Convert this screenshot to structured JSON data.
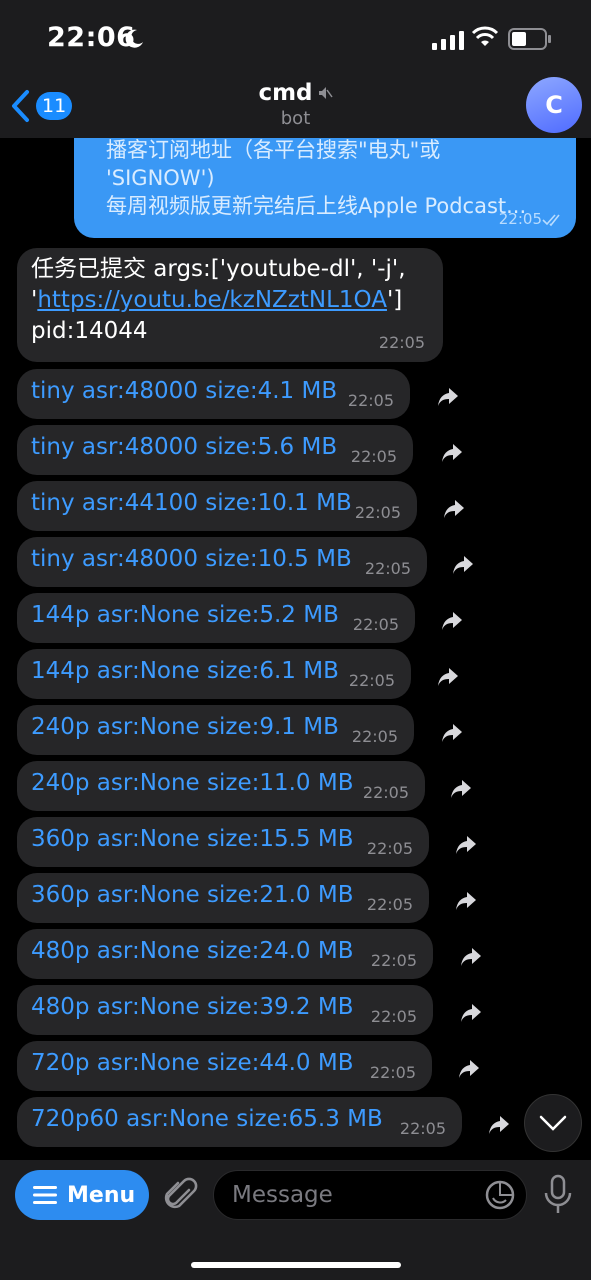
{
  "status_bar": {
    "time": "22:06"
  },
  "nav": {
    "back_count": "11",
    "title": "cmd",
    "subtitle": "bot",
    "avatar_letter": "C"
  },
  "outgoing": {
    "lines": [
      "播客订阅地址（各平台搜索\"电丸\"或",
      "'SIGNOW')",
      "每周视频版更新完结后上线Apple Podcast..."
    ],
    "time": "22:05"
  },
  "task_message": {
    "line1": "任务已提交 args:['youtube-dl', '-j',",
    "line2_prefix": "'",
    "link": "https://youtu.be/kzNZztNL1OA",
    "line2_suffix": "']",
    "line3": "pid:14044",
    "time": "22:05"
  },
  "formats": [
    {
      "label": "tiny asr:48000 size:4.1 MB",
      "time": "22:05"
    },
    {
      "label": "tiny asr:48000 size:5.6 MB",
      "time": "22:05"
    },
    {
      "label": "tiny asr:44100 size:10.1 MB",
      "time": "22:05"
    },
    {
      "label": "tiny asr:48000 size:10.5 MB",
      "time": "22:05"
    },
    {
      "label": "144p asr:None size:5.2 MB",
      "time": "22:05"
    },
    {
      "label": "144p asr:None size:6.1 MB",
      "time": "22:05"
    },
    {
      "label": "240p asr:None size:9.1 MB",
      "time": "22:05"
    },
    {
      "label": "240p asr:None size:11.0 MB",
      "time": "22:05"
    },
    {
      "label": "360p asr:None size:15.5 MB",
      "time": "22:05"
    },
    {
      "label": "360p asr:None size:21.0 MB",
      "time": "22:05"
    },
    {
      "label": "480p asr:None size:24.0 MB",
      "time": "22:05"
    },
    {
      "label": "480p asr:None size:39.2 MB",
      "time": "22:05"
    },
    {
      "label": "720p asr:None size:44.0 MB",
      "time": "22:05"
    },
    {
      "label": "720p60 asr:None size:65.3 MB",
      "time": "22:05"
    }
  ],
  "input_bar": {
    "menu_label": "Menu",
    "message_placeholder": "Message"
  },
  "colors": {
    "accent": "#3d9bff",
    "outgoing_bubble": "#3a98f5",
    "incoming_bubble": "#262628"
  }
}
